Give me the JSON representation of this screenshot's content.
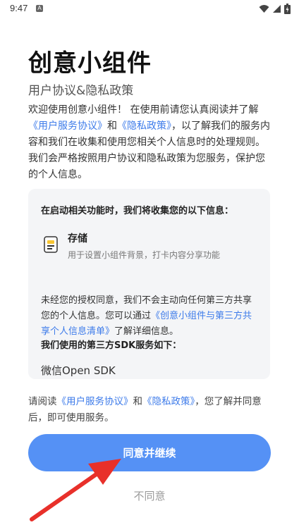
{
  "status_bar": {
    "time": "9:47",
    "notification_letter": "A"
  },
  "page": {
    "title": "创意小组件",
    "subtitle": "用户协议&隐私政策",
    "intro_1": "欢迎使用创意小组件！ 在使用前请您认真阅读并了解",
    "intro_link_1": "《用户服务协议》",
    "intro_2": "和",
    "intro_link_2": "《隐私政策》",
    "intro_3": "，以了解我们的服务内容和我们在收集和使用您相关个人信息时的处理规则。我们会严格按照用户协议和隐私政策为您服务，保护您的个人信息。"
  },
  "info_card": {
    "heading": "在启动相关功能时，我们将收集您的以下信息：",
    "permission": {
      "icon": "storage-icon",
      "title": "存储",
      "description": "用于设置小组件背景，打卡内容分享功能"
    },
    "consent_1": "未经您的授权同意，我们不会主动向任何第三方共享您的个人信息。您可以通过",
    "consent_link": "《创意小组件与第三方共享个人信息清单》",
    "consent_2": "了解详细信息。",
    "sdk_heading": "我们使用的第三方SDK服务如下：",
    "sdk_item": "微信Open SDK"
  },
  "bottom": {
    "text_1": "请阅读",
    "link_1": "《用户服务协议》",
    "text_2": "和",
    "link_2": "《隐私政策》",
    "text_3": "，您了解并同意后，即可使用服务。"
  },
  "buttons": {
    "agree_label": "同意并继续",
    "disagree_label": "不同意"
  },
  "colors": {
    "accent": "#5591f5",
    "link": "#3d7bea",
    "arrow": "#e8302a"
  }
}
